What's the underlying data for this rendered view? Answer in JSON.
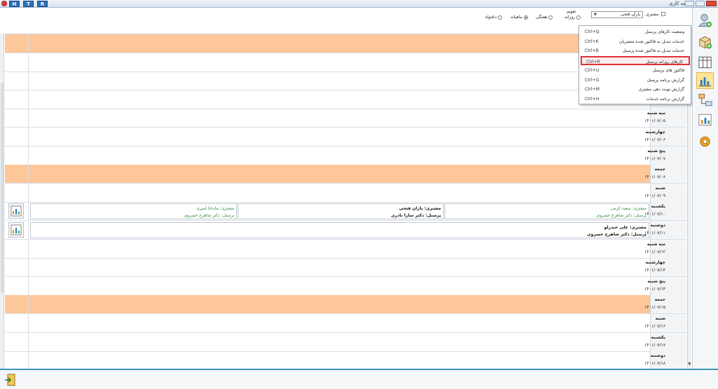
{
  "window": {
    "title": "برنامه کاری",
    "quick_buttons": [
      "H",
      "T",
      "R"
    ]
  },
  "header": {
    "view_group_label": "تقویم",
    "views": [
      {
        "label": "روزانه",
        "selected": false
      },
      {
        "label": "هفتگی",
        "selected": false
      },
      {
        "label": "ماهیانه",
        "selected": true
      },
      {
        "label": "دلخواه",
        "selected": false
      }
    ],
    "customer_checkbox_label": "مشتری",
    "customer_value": "یاران فتحی"
  },
  "menu": {
    "items": [
      {
        "label": "وضعیت کارهای پرسنل",
        "shortcut": "Ctrl+Q",
        "highlighted": false
      },
      {
        "label": "خدمات تبدیل به فاکتور شده مشتریان",
        "shortcut": "Ctrl+K",
        "highlighted": false
      },
      {
        "label": "خدمات تبدیل به فاکتور شده پرسنل",
        "shortcut": "Ctrl+B",
        "highlighted": false
      },
      {
        "label": "کارهای روزانه پرسنل",
        "shortcut": "Ctrl+R",
        "highlighted": true
      },
      {
        "label": "فاکتور های پرسنل",
        "shortcut": "Ctrl+U",
        "highlighted": false
      },
      {
        "label": "گزارش برنامه پرسنل",
        "shortcut": "Ctrl+G",
        "highlighted": false
      },
      {
        "label": "گزارش نوبت دهی مشتری",
        "shortcut": "Ctrl+M",
        "highlighted": false
      },
      {
        "label": "گزارش برنامه خدمات",
        "shortcut": "Ctrl+H",
        "highlighted": false
      }
    ]
  },
  "days": [
    {
      "weekday": "",
      "date": "",
      "holiday": true
    },
    {
      "weekday": "",
      "date": "",
      "holiday": false
    },
    {
      "weekday": "",
      "date": "",
      "holiday": false
    },
    {
      "weekday": "",
      "date": "",
      "holiday": false
    },
    {
      "weekday": "سه شنبه",
      "date": "۱۴۰۱/۰۷/۰۵",
      "holiday": false
    },
    {
      "weekday": "چهارشنبه",
      "date": "۱۴۰۱/۰۷/۰۶",
      "holiday": false
    },
    {
      "weekday": "پنج شنبه",
      "date": "۱۴۰۱/۰۷/۰۷",
      "holiday": false
    },
    {
      "weekday": "جمعه",
      "date": "۱۴۰۱/۰۷/۰۸",
      "holiday": true
    },
    {
      "weekday": "شنبه",
      "date": "۱۴۰۱/۰۷/۰۹",
      "holiday": false
    },
    {
      "weekday": "یکشنبه",
      "date": "۱۴۰۱/۰۷/۱۰",
      "holiday": false
    },
    {
      "weekday": "دوشنبه",
      "date": "۱۴۰۱/۰۷/۱۱",
      "holiday": false
    },
    {
      "weekday": "سه شنبه",
      "date": "۱۴۰۱/۰۷/۱۲",
      "holiday": false
    },
    {
      "weekday": "چهارشنبه",
      "date": "۱۴۰۱/۰۷/۱۳",
      "holiday": false
    },
    {
      "weekday": "پنج شنبه",
      "date": "۱۴۰۱/۰۷/۱۴",
      "holiday": false
    },
    {
      "weekday": "جمعه",
      "date": "۱۴۰۱/۰۷/۱۵",
      "holiday": true
    },
    {
      "weekday": "شنبه",
      "date": "۱۴۰۱/۰۷/۱۶",
      "holiday": false
    },
    {
      "weekday": "یکشنبه",
      "date": "۱۴۰۱/۰۷/۱۷",
      "holiday": false
    },
    {
      "weekday": "دوشنبه",
      "date": "۱۴۰۱/۰۷/۱۸",
      "holiday": false
    }
  ],
  "appointments": {
    "yekshanbe": [
      {
        "customer": "مشتری: سعید کرمی",
        "staff": "پرسنل: دکتر شاهرخ خسروی",
        "style": "green"
      },
      {
        "customer": "مشتری: یاران فتحی",
        "staff": "پرسنل: دکتر سارا نادری",
        "style": "dark"
      },
      {
        "customer": "مشتری: ماندانا امیری",
        "staff": "پرسنل: دکتر شاهرخ خسروی",
        "style": "green"
      }
    ],
    "doshanbe": [
      {
        "customer": "مشتری: علی حیدرلو",
        "staff": "پرسنل: دکتر شاهرخ خسروی",
        "style": "dark"
      }
    ]
  },
  "colors": {
    "holiday": "#fdc79a",
    "accent": "#3a97b8",
    "highlight": "#e0323a"
  }
}
